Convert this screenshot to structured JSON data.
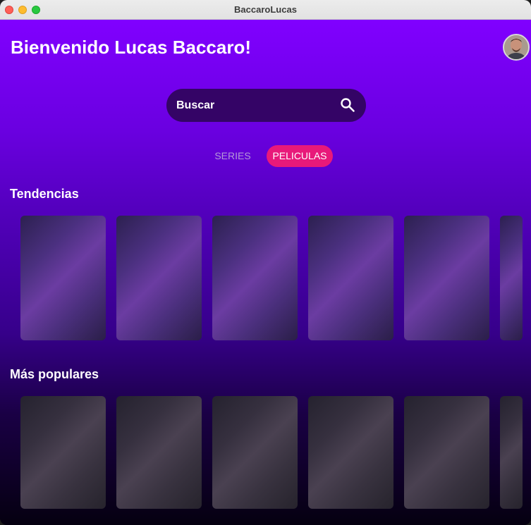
{
  "window": {
    "title": "BaccaroLucas"
  },
  "header": {
    "welcome": "Bienvenido Lucas Baccaro!"
  },
  "search": {
    "placeholder": "Buscar",
    "value": ""
  },
  "tabs": [
    {
      "label": "SERIES",
      "selected": false
    },
    {
      "label": "PELICULAS",
      "selected": true
    }
  ],
  "sections": [
    {
      "title": "Tendencias",
      "cards": 6
    },
    {
      "title": "Más populares",
      "cards": 6
    }
  ],
  "colors": {
    "accent": "#e8197a",
    "background_top": "#8000ff",
    "background_bottom": "#050010",
    "search_bg": "#340466"
  },
  "icons": {
    "search": "search-icon",
    "profile": "avatar"
  }
}
